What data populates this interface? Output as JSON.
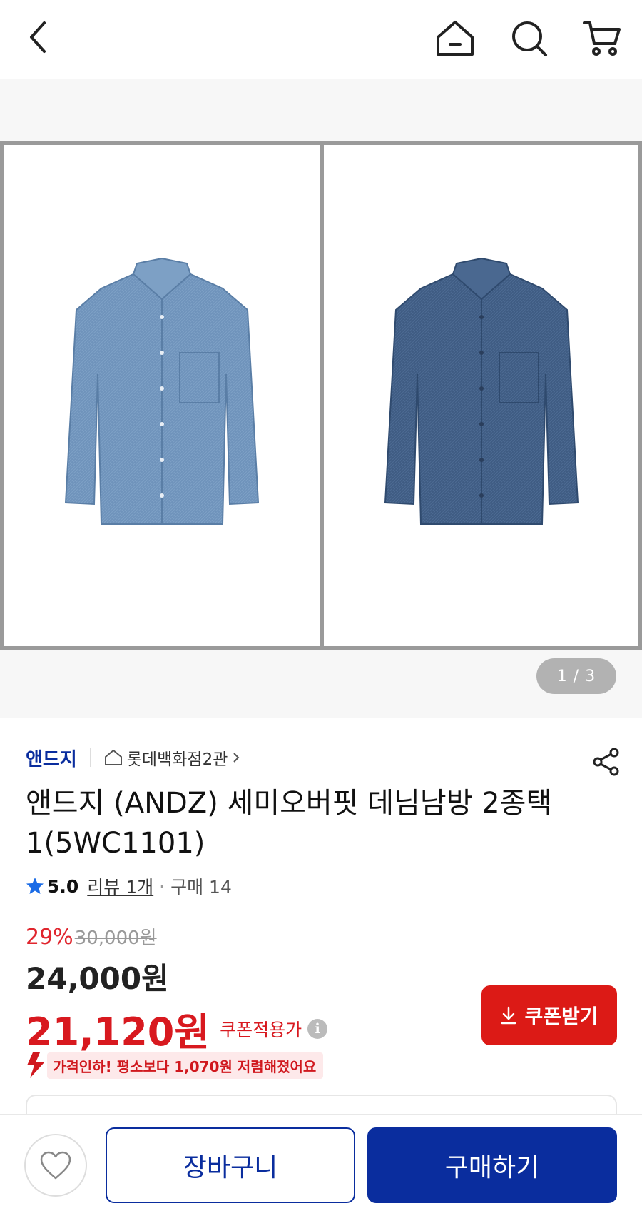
{
  "header": {
    "back_icon": "chevron-left-icon",
    "home_icon": "home-icon",
    "search_icon": "search-icon",
    "cart_icon": "cart-icon"
  },
  "gallery": {
    "images": [
      {
        "description_icon": "denim-shirt-light",
        "color": "#6f93bb"
      },
      {
        "description_icon": "denim-shirt-dark",
        "color": "#3f5c83"
      }
    ],
    "pager": "1 / 3"
  },
  "product": {
    "brand": "앤드지",
    "store": "롯데백화점2관",
    "title": "앤드지 (ANDZ) 세미오버핏 데님남방 2종택1(5WC1101)",
    "rating": "5.0",
    "review": "리뷰 1개",
    "purchase": "구매 14",
    "discount_rate": "29%",
    "original_price": "30,000원",
    "sale_price": "24,000원",
    "coupon_price": "21,120원",
    "coupon_label": "쿠폰적용가",
    "coupon_button": "쿠폰받기",
    "price_drop_text": "가격인하! 평소보다 1,070원 저렴해졌어요"
  },
  "bottom": {
    "cart_button": "장바구니",
    "buy_button": "구매하기"
  },
  "colors": {
    "brand_blue": "#0a2d9e",
    "accent_red": "#dc1a16"
  }
}
